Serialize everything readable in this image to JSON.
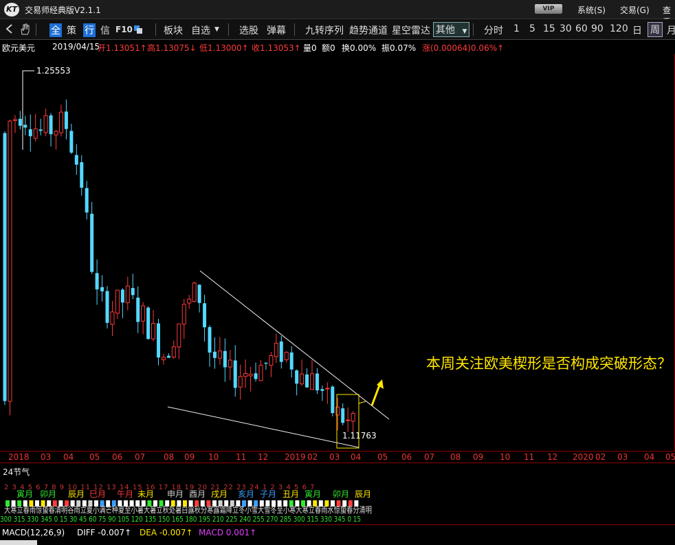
{
  "app": {
    "title": "交易师经典版V2.1.1",
    "logo_text": "KT",
    "vip": "VIP",
    "menu": [
      "系统(S)",
      "交易(G)",
      "查看"
    ]
  },
  "toolbar": {
    "icons": [
      "back-arrow-icon",
      "hand-icon"
    ],
    "quick_full": "全",
    "quick_strategy": "策",
    "quick_row": "行",
    "quick_info": "信",
    "quick_f10": "F10",
    "items": [
      "板块",
      "自选",
      "选股",
      "弹幕",
      "九转序列",
      "趋势通道",
      "星空雷达"
    ],
    "other": "其他",
    "periods": [
      "分时",
      "1",
      "5",
      "15",
      "30",
      "60",
      "90",
      "120",
      "日",
      "周",
      "月"
    ],
    "active_period": "周"
  },
  "quote": {
    "symbol": "欧元美元",
    "date": "2019/04/15",
    "open": "开1.13051↑",
    "high": "高1.13075↓",
    "low": "低1.13000↑",
    "close": "收1.13053↑",
    "volume": "量0",
    "amount": "额0",
    "turnover": "换0.00%",
    "amplitude": "振0.07%",
    "change": "涨(0.00064)0.06%↑",
    "colors": {
      "up": "#ff3b3b",
      "down": "#54d8ff",
      "label": "#ffffff",
      "yellow": "#ffe600"
    }
  },
  "chart": {
    "max_label": "1.25553",
    "min_label": "1.11763",
    "annotation": "本周关注欧美楔形是否构成突破形态？"
  },
  "time_axis": {
    "labels": [
      "2018",
      "03",
      "04",
      "05",
      "06",
      "07",
      "08",
      "09",
      "10",
      "11",
      "12",
      "2019",
      "02",
      "03",
      "04",
      "05",
      "06",
      "07",
      "08",
      "09",
      "10",
      "11",
      "12",
      "2020",
      "02",
      "03",
      "04",
      "05"
    ]
  },
  "solar_terms": {
    "title": "24节气",
    "months": [
      "寅月",
      "卯月",
      "辰月",
      "巳月",
      "午月",
      "未月",
      "申月",
      "酉月",
      "戌月",
      "亥月",
      "子月",
      "丑月",
      "寅月",
      "卯月",
      "辰月"
    ],
    "terms_line": "大寒立春雨惊蛰春清明谷雨立夏小满芒种夏至小暑大暑立秋处暑白露秋分寒露霜降立冬小雪大雪冬至小寒大寒立春雨水惊蛰春分清明",
    "degrees_line": "300 315 330 345 0 15 30 45 60 75 90 105 120 135 150 165 180 195 210 225 240 255 270 285 300 315 330 345 0 15",
    "numbers_top": "2 3 4 5 6 7 8 9 10 11 12 13 14 15 16 17 18 19 20 21 22 23 24 1 2 3 4 5 6 7"
  },
  "macd": {
    "label": "MACD(12,26,9)",
    "diff": "DIFF -0.007↑",
    "dea": "DEA -0.007↑",
    "macd": "MACD 0.001↑"
  }
}
